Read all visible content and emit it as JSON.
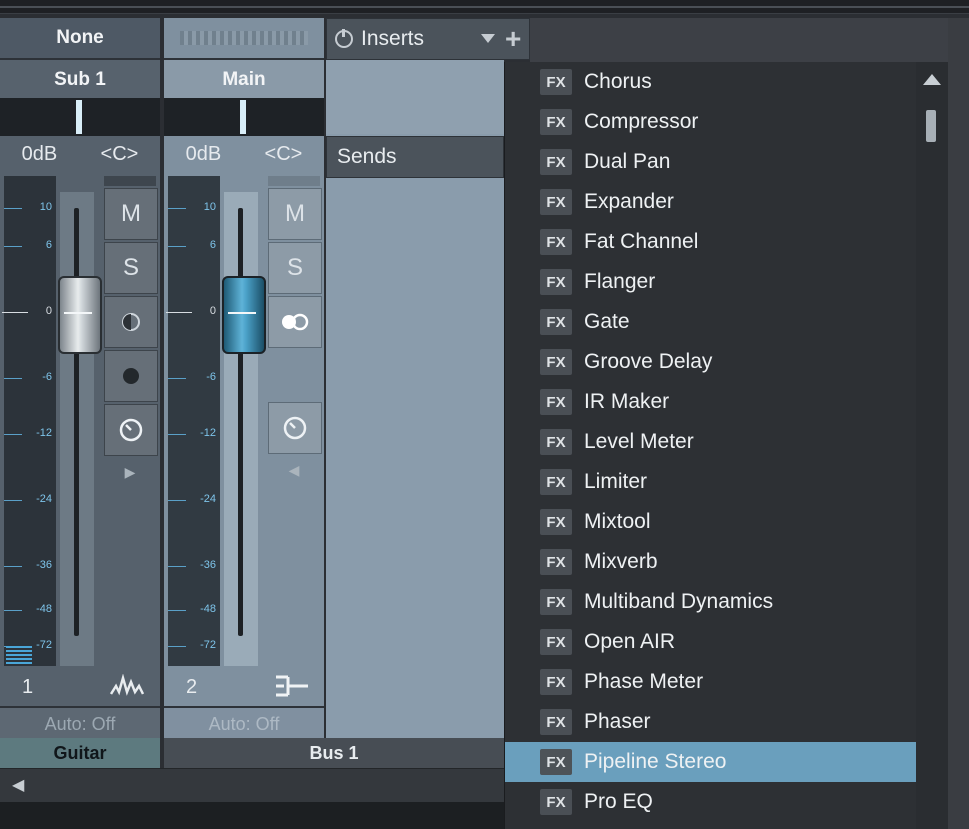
{
  "strips": [
    {
      "top_label": "None",
      "name": "Sub 1",
      "volume": "0dB",
      "pan": "<C>",
      "buttons": [
        "M",
        "S"
      ],
      "number": "1",
      "auto": "Auto: Off",
      "group": "Guitar"
    },
    {
      "top_label": "",
      "name": "Main",
      "volume": "0dB",
      "pan": "<C>",
      "buttons": [
        "M",
        "S"
      ],
      "number": "2",
      "auto": "Auto: Off",
      "group": "Bus 1"
    }
  ],
  "meter_scale": [
    "10",
    "6",
    "0",
    "-6",
    "-12",
    "-24",
    "-36",
    "-48",
    "-72"
  ],
  "inserts": {
    "label": "Inserts",
    "add": "+"
  },
  "sends": {
    "label": "Sends"
  },
  "menu": {
    "items": [
      "Chorus",
      "Compressor",
      "Dual Pan",
      "Expander",
      "Fat Channel",
      "Flanger",
      "Gate",
      "Groove Delay",
      "IR Maker",
      "Level Meter",
      "Limiter",
      "Mixtool",
      "Mixverb",
      "Multiband Dynamics",
      "Open AIR",
      "Phase Meter",
      "Phaser",
      "Pipeline Stereo",
      "Pro EQ"
    ],
    "badge": "FX",
    "selected": "Pipeline Stereo"
  },
  "icons": {
    "power": "power-icon",
    "dropdown": "dropdown-triangle-icon",
    "add": "plus-icon",
    "mono": "mono-icon",
    "link": "stereo-link-icon",
    "record": "record-icon",
    "monitor": "monitor-icon",
    "waveform": "waveform-icon",
    "bus": "bus-icon"
  },
  "colors": {
    "accent": "#6a9fbd",
    "fader_blue": "#4ba2c9",
    "group_guitar": "#5d7a7f"
  }
}
